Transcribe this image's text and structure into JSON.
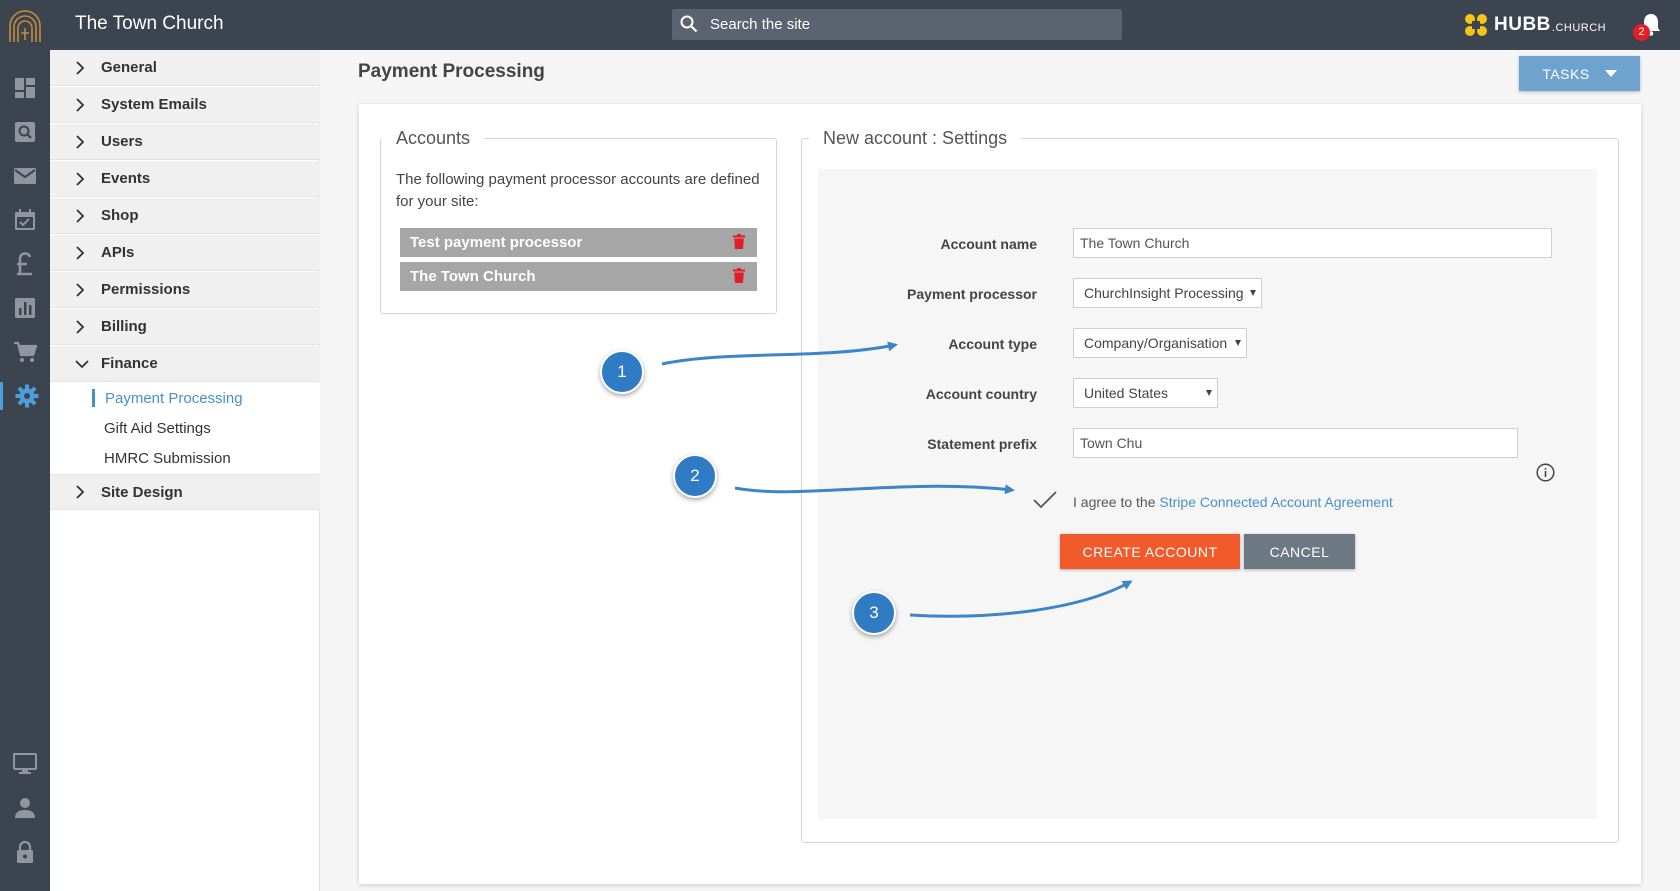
{
  "app": {
    "site_title": "The Town Church",
    "search_placeholder": "Search the site",
    "brand": "HUBB",
    "brand_suffix": ".CHURCH",
    "notification_count": "2"
  },
  "rail_icons": [
    "dashboard-icon",
    "search-icon",
    "mail-icon",
    "calendar-icon",
    "pound-icon",
    "chart-icon",
    "cart-icon",
    "gear-icon",
    "monitor-icon",
    "user-icon",
    "lock-icon"
  ],
  "nav": {
    "items": [
      {
        "label": "General"
      },
      {
        "label": "System Emails"
      },
      {
        "label": "Users"
      },
      {
        "label": "Events"
      },
      {
        "label": "Shop"
      },
      {
        "label": "APIs"
      },
      {
        "label": "Permissions"
      },
      {
        "label": "Billing"
      },
      {
        "label": "Finance"
      }
    ],
    "finance_sub": [
      {
        "label": "Payment Processing"
      },
      {
        "label": "Gift Aid Settings"
      },
      {
        "label": "HMRC Submission"
      }
    ],
    "after": {
      "label": "Site Design"
    }
  },
  "main": {
    "title": "Payment Processing",
    "tasks_label": "TASKS"
  },
  "accounts": {
    "legend": "Accounts",
    "description": "The following payment processor accounts are defined for your site:",
    "rows": [
      {
        "name": "Test payment processor"
      },
      {
        "name": "The Town Church"
      }
    ]
  },
  "settings": {
    "legend": "New account : Settings",
    "fields": {
      "account_name": {
        "label": "Account name",
        "value": "The Town Church"
      },
      "payment_processor": {
        "label": "Payment processor",
        "value": "ChurchInsight Processing"
      },
      "account_type": {
        "label": "Account type",
        "value": "Company/Organisation"
      },
      "account_country": {
        "label": "Account country",
        "value": "United States"
      },
      "statement_prefix": {
        "label": "Statement prefix",
        "value": "Town Chu"
      }
    },
    "agree_text": "I agree to the ",
    "agree_link": "Stripe Connected Account Agreement",
    "create_label": "CREATE ACCOUNT",
    "cancel_label": "CANCEL"
  },
  "annotations": {
    "steps": [
      "1",
      "2",
      "3"
    ],
    "color": "#2f7cc4"
  },
  "colors": {
    "topbar": "#3c4450",
    "accent": "#4a90c8",
    "create_button": "#f15a2b",
    "cancel_button": "#6c7883",
    "brand_yellow": "#f5c518"
  }
}
